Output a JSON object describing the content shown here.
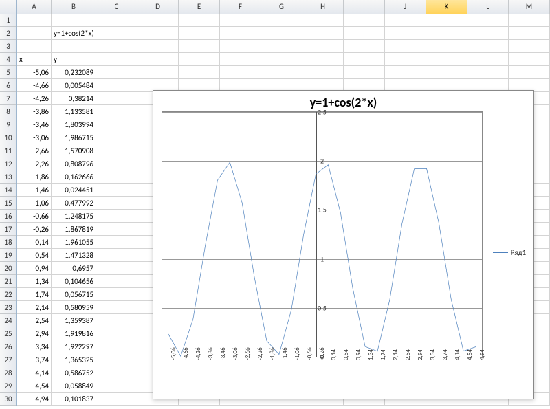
{
  "columns": [
    "A",
    "B",
    "C",
    "D",
    "E",
    "F",
    "G",
    "H",
    "I",
    "J",
    "K",
    "L",
    "M"
  ],
  "selected_column": "K",
  "row_count": 30,
  "header": {
    "x": "x",
    "y": "y"
  },
  "formula_label": "y=1+cos(2*x)",
  "data_rows": [
    {
      "x": "-5,06",
      "y": "0,232089"
    },
    {
      "x": "-4,66",
      "y": "0,005484"
    },
    {
      "x": "-4,26",
      "y": "0,38214"
    },
    {
      "x": "-3,86",
      "y": "1,133581"
    },
    {
      "x": "-3,46",
      "y": "1,803994"
    },
    {
      "x": "-3,06",
      "y": "1,986715"
    },
    {
      "x": "-2,66",
      "y": "1,570908"
    },
    {
      "x": "-2,26",
      "y": "0,808796"
    },
    {
      "x": "-1,86",
      "y": "0,162666"
    },
    {
      "x": "-1,46",
      "y": "0,024451"
    },
    {
      "x": "-1,06",
      "y": "0,477992"
    },
    {
      "x": "-0,66",
      "y": "1,248175"
    },
    {
      "x": "-0,26",
      "y": "1,867819"
    },
    {
      "x": "0,14",
      "y": "1,961055"
    },
    {
      "x": "0,54",
      "y": "1,471328"
    },
    {
      "x": "0,94",
      "y": "0,6957"
    },
    {
      "x": "1,34",
      "y": "0,104656"
    },
    {
      "x": "1,74",
      "y": "0,056715"
    },
    {
      "x": "2,14",
      "y": "0,580959"
    },
    {
      "x": "2,54",
      "y": "1,359387"
    },
    {
      "x": "2,94",
      "y": "1,919816"
    },
    {
      "x": "3,34",
      "y": "1,922297"
    },
    {
      "x": "3,74",
      "y": "1,365325"
    },
    {
      "x": "4,14",
      "y": "0,586752"
    },
    {
      "x": "4,54",
      "y": "0,058849"
    },
    {
      "x": "4,94",
      "y": "0,101837"
    }
  ],
  "chart_data": {
    "type": "line",
    "title": "y=1+cos(2*x)",
    "xlabel": "",
    "ylabel": "",
    "ylim": [
      0,
      2.5
    ],
    "y_ticks": [
      0,
      0.5,
      1,
      1.5,
      2,
      2.5
    ],
    "y_tick_labels": [
      "0",
      "0,5",
      "1",
      "1,5",
      "2",
      "2,5"
    ],
    "categories": [
      "-5,06",
      "-4,66",
      "-4,26",
      "-3,86",
      "-3,46",
      "-3,06",
      "-2,66",
      "-2,26",
      "-1,86",
      "-1,46",
      "-1,06",
      "-0,66",
      "-0,26",
      "0,14",
      "0,54",
      "0,94",
      "1,34",
      "1,74",
      "2,14",
      "2,54",
      "2,94",
      "3,34",
      "3,74",
      "4,14",
      "4,54",
      "4,94"
    ],
    "series": [
      {
        "name": "Ряд1",
        "color": "#4e81bd",
        "values": [
          0.232089,
          0.005484,
          0.38214,
          1.133581,
          1.803994,
          1.986715,
          1.570908,
          0.808796,
          0.162666,
          0.024451,
          0.477992,
          1.248175,
          1.867819,
          1.961055,
          1.471328,
          0.6957,
          0.104656,
          0.056715,
          0.580959,
          1.359387,
          1.919816,
          1.922297,
          1.365325,
          0.586752,
          0.058849,
          0.101837
        ]
      }
    ],
    "legend_position": "right"
  }
}
